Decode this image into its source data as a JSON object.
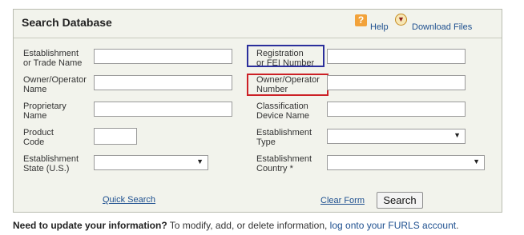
{
  "header": {
    "title": "Search Database",
    "help_label": "Help",
    "download_label": "Download Files"
  },
  "form": {
    "left_fields": [
      {
        "label_line1": "Establishment",
        "label_line2": "or Trade Name",
        "value": ""
      },
      {
        "label_line1": "Owner/Operator",
        "label_line2": "Name",
        "value": ""
      },
      {
        "label_line1": "Proprietary",
        "label_line2": "Name",
        "value": ""
      },
      {
        "label_line1": "Product",
        "label_line2": "Code",
        "value": ""
      },
      {
        "label_line1": "Establishment",
        "label_line2": "State (U.S.)",
        "value": ""
      }
    ],
    "right_fields": [
      {
        "label_line1": "Registration",
        "label_line2": "or FEI Number",
        "value": ""
      },
      {
        "label_line1": "Owner/Operator",
        "label_line2": "Number",
        "value": ""
      },
      {
        "label_line1": "Classification",
        "label_line2": "Device Name",
        "value": ""
      },
      {
        "label_line1": "Establishment",
        "label_line2": "Type",
        "value": ""
      },
      {
        "label_line1": "Establishment",
        "label_line2": "Country *",
        "value": ""
      }
    ],
    "quick_search_label": "Quick Search",
    "clear_form_label": "Clear Form",
    "search_button_label": "Search"
  },
  "footer": {
    "bold_text": "Need to update your information?",
    "text": " To modify, add, or delete information, ",
    "link_text": "log onto your FURLS account",
    "end_text": "."
  },
  "highlights": {
    "blue": "#2b2f9c",
    "red": "#cc2026"
  },
  "icons": {
    "help": "help-icon",
    "download": "download-icon",
    "dropdown": "chevron-down-icon"
  }
}
